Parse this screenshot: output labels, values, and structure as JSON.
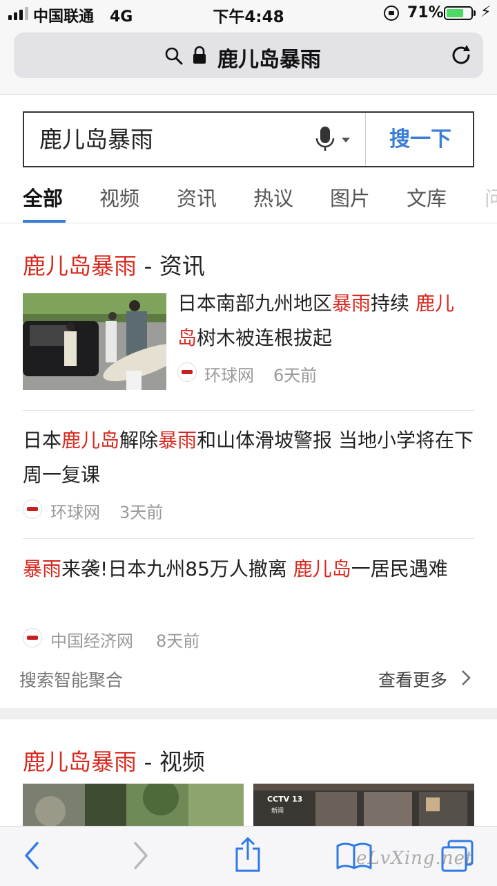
{
  "status_bar": {
    "carrier": "中国联通",
    "network": "4G",
    "time": "下午4:48",
    "battery_percent": "71%",
    "battery_level": 0.71
  },
  "address_bar": {
    "url_text": "鹿儿岛暴雨"
  },
  "search": {
    "query": "鹿儿岛暴雨",
    "button_label": "搜一下"
  },
  "tabs": [
    {
      "label": "全部",
      "active": true
    },
    {
      "label": "视频",
      "active": false
    },
    {
      "label": "资讯",
      "active": false
    },
    {
      "label": "热议",
      "active": false
    },
    {
      "label": "图片",
      "active": false
    },
    {
      "label": "文库",
      "active": false
    },
    {
      "label": "问",
      "active": false
    }
  ],
  "news_section": {
    "title_keyword": "鹿儿岛暴雨",
    "title_suffix": " - 资讯",
    "items": [
      {
        "title_parts": [
          "日本南部九州地区",
          "暴雨",
          "持续 ",
          "鹿儿岛",
          "树木被连根拔起"
        ],
        "source": "环球网",
        "time": "6天前"
      },
      {
        "title_parts": [
          "日本",
          "鹿儿岛",
          "解除",
          "暴雨",
          "和山体滑坡警报 当地小学将在下周一复课"
        ],
        "source": "环球网",
        "time": "3天前"
      },
      {
        "title_parts": [
          "暴雨",
          "来袭!日本九州85万人撤离 ",
          "鹿儿岛",
          "一居民遇难"
        ],
        "source": "中国经济网",
        "time": "8天前"
      }
    ],
    "footer_left": "搜索智能聚合",
    "footer_right": "查看更多"
  },
  "video_section": {
    "title_keyword": "鹿儿岛暴雨",
    "title_suffix": " - 视频",
    "thumb2_logo": "CCTV 13",
    "thumb2_sub": "新闻"
  },
  "watermark": "eLvXing.net",
  "colors": {
    "highlight": "#d9281e",
    "accent": "#3a7fd5",
    "toolbar_icon": "#2f7ae5"
  }
}
